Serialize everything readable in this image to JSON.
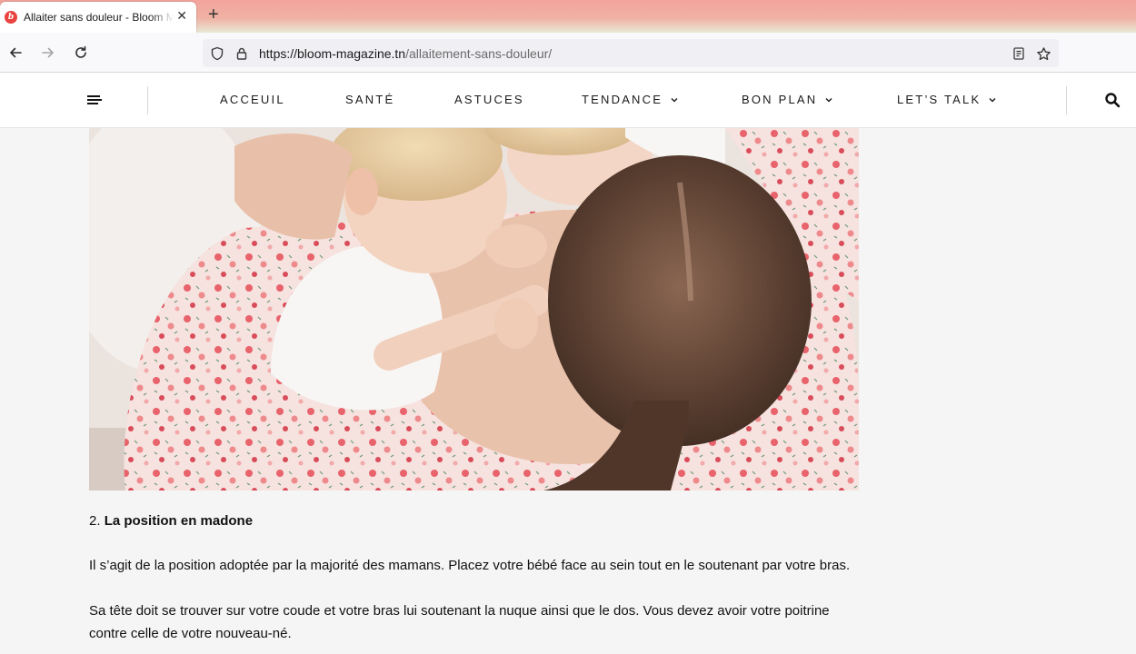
{
  "browser": {
    "tab": {
      "title": "Allaiter sans douleur - Bloom Magazine",
      "favicon_letter": "b"
    },
    "new_tab_label": "+",
    "url": {
      "host": "https://bloom-magazine.tn",
      "path": "/allaitement-sans-douleur/"
    }
  },
  "site": {
    "menu": [
      {
        "label": "ACCEUIL",
        "has_dropdown": false
      },
      {
        "label": "SANTÉ",
        "has_dropdown": false
      },
      {
        "label": "ASTUCES",
        "has_dropdown": false
      },
      {
        "label": "TENDANCE",
        "has_dropdown": true
      },
      {
        "label": "BON PLAN",
        "has_dropdown": true
      },
      {
        "label": "LET’S TALK",
        "has_dropdown": true
      }
    ]
  },
  "article": {
    "section_number": "2.",
    "section_title": "La position en madone",
    "paragraph_1": "Il s’agit de la position adoptée par la majorité des mamans. Placez votre bébé face au sein tout en le soutenant par votre bras.",
    "paragraph_2_line_1": "Sa tête doit se trouver sur votre coude et votre bras lui soutenant la nuque  ainsi que le dos. Vous devez avoir votre poitrine",
    "paragraph_2_line_2": "contre celle de votre nouveau-né."
  },
  "colors": {
    "brand_red": "#e8433f",
    "floral_pink": "#e86a72",
    "page_bg": "#f5f5f5"
  }
}
